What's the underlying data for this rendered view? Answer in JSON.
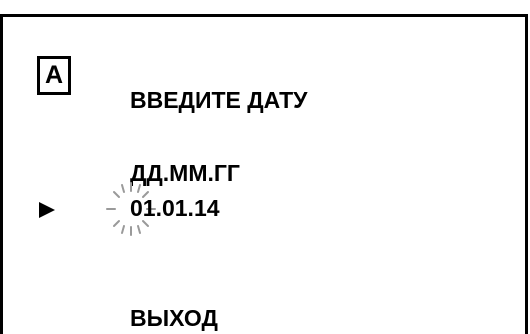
{
  "screen": {
    "mode_badge": "A",
    "title": "ВВЕДИТЕ ДАТУ",
    "date_format": "ДД.ММ.ГГ",
    "date_value": "01.01.14",
    "exit_label": "ВЫХОД",
    "cursor_icon": "right-triangle-pointer",
    "edit_indicator_icon": "blinking-digit-icon"
  }
}
